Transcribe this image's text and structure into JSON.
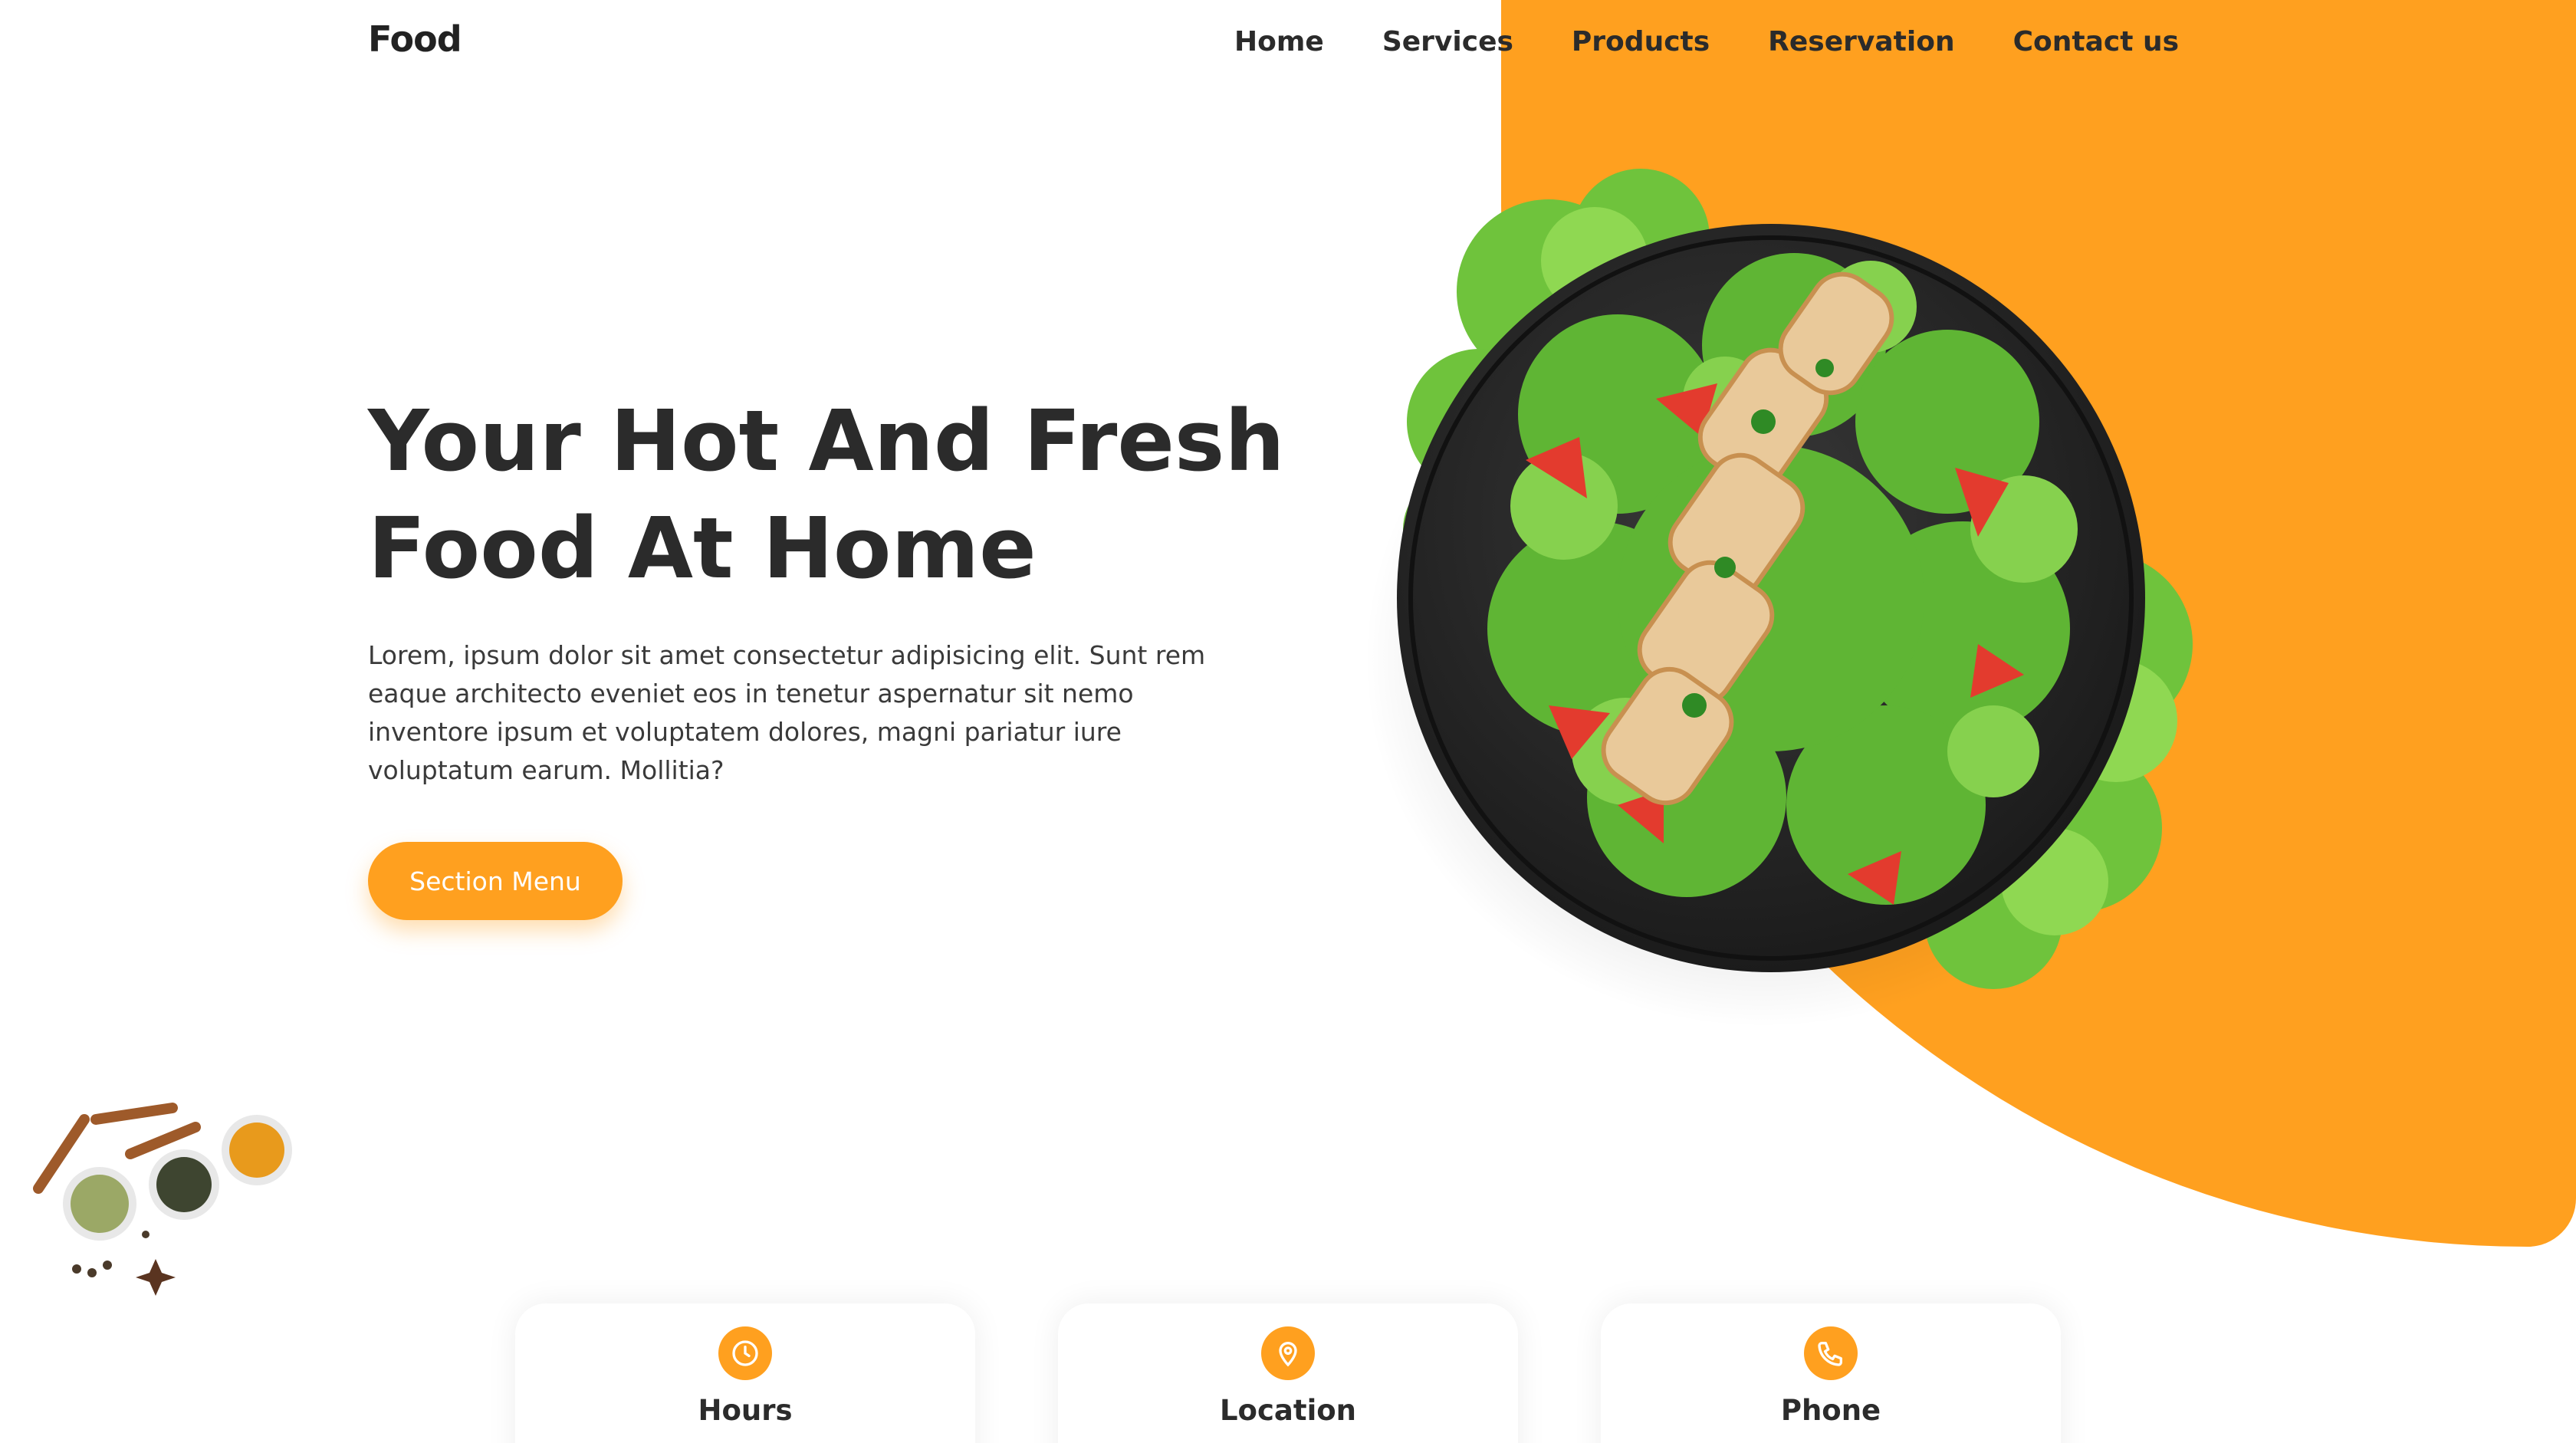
{
  "brand": {
    "logo": "Food"
  },
  "nav": {
    "items": [
      {
        "label": "Home"
      },
      {
        "label": "Services"
      },
      {
        "label": "Products"
      },
      {
        "label": "Reservation"
      },
      {
        "label": "Contact us"
      }
    ]
  },
  "hero": {
    "title_line1": "Your Hot And Fresh",
    "title_line2": "Food At Home",
    "description": "Lorem, ipsum dolor sit amet consectetur adipisicing elit. Sunt rem eaque architecto eveniet eos in tenetur aspernatur sit nemo inventore ipsum et voluptatem dolores, magni pariatur iure voluptatum earum. Mollitia?",
    "cta_label": "Section Menu"
  },
  "cards": [
    {
      "title": "Hours",
      "icon": "clock-icon"
    },
    {
      "title": "Location",
      "icon": "location-pin-icon"
    },
    {
      "title": "Phone",
      "icon": "phone-icon"
    }
  ],
  "colors": {
    "accent": "#FFA01F",
    "text": "#2b2b2b",
    "background": "#ffffff"
  }
}
